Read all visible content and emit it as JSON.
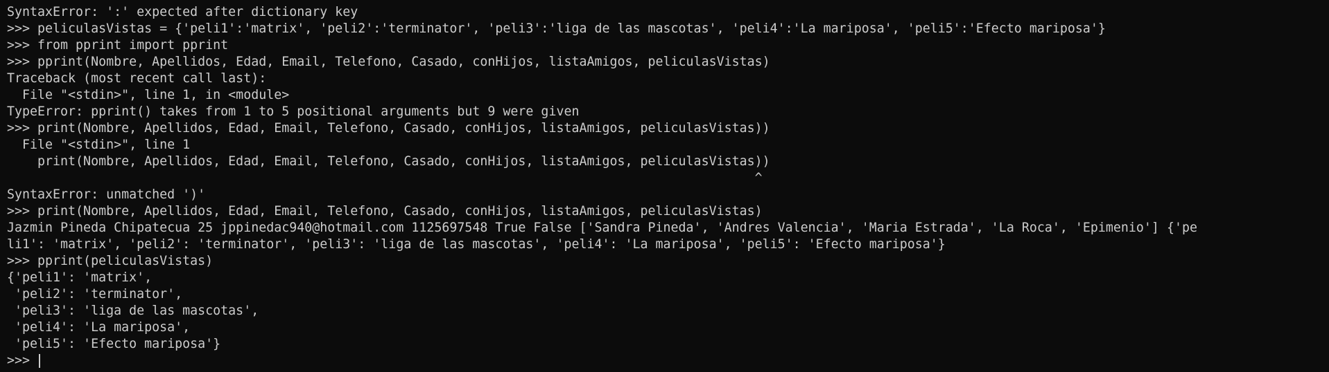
{
  "terminal": {
    "lines": [
      "SyntaxError: ':' expected after dictionary key",
      ">>> peliculasVistas = {'peli1':'matrix', 'peli2':'terminator', 'peli3':'liga de las mascotas', 'peli4':'La mariposa', 'peli5':'Efecto mariposa'}",
      ">>> from pprint import pprint",
      ">>> pprint(Nombre, Apellidos, Edad, Email, Telefono, Casado, conHijos, listaAmigos, peliculasVistas)",
      "Traceback (most recent call last):",
      "  File \"<stdin>\", line 1, in <module>",
      "TypeError: pprint() takes from 1 to 5 positional arguments but 9 were given",
      ">>> print(Nombre, Apellidos, Edad, Email, Telefono, Casado, conHijos, listaAmigos, peliculasVistas))",
      "  File \"<stdin>\", line 1",
      "    print(Nombre, Apellidos, Edad, Email, Telefono, Casado, conHijos, listaAmigos, peliculasVistas))",
      "                                                                                                  ^",
      "SyntaxError: unmatched ')'",
      ">>> print(Nombre, Apellidos, Edad, Email, Telefono, Casado, conHijos, listaAmigos, peliculasVistas)",
      "Jazmin Pineda Chipatecua 25 jppinedac940@hotmail.com 1125697548 True False ['Sandra Pineda', 'Andres Valencia', 'Maria Estrada', 'La Roca', 'Epimenio'] {'pe",
      "li1': 'matrix', 'peli2': 'terminator', 'peli3': 'liga de las mascotas', 'peli4': 'La mariposa', 'peli5': 'Efecto mariposa'}",
      ">>> pprint(peliculasVistas)",
      "{'peli1': 'matrix',",
      " 'peli2': 'terminator',",
      " 'peli3': 'liga de las mascotas',",
      " 'peli4': 'La mariposa',",
      " 'peli5': 'Efecto mariposa'}"
    ],
    "prompt": ">>> "
  }
}
